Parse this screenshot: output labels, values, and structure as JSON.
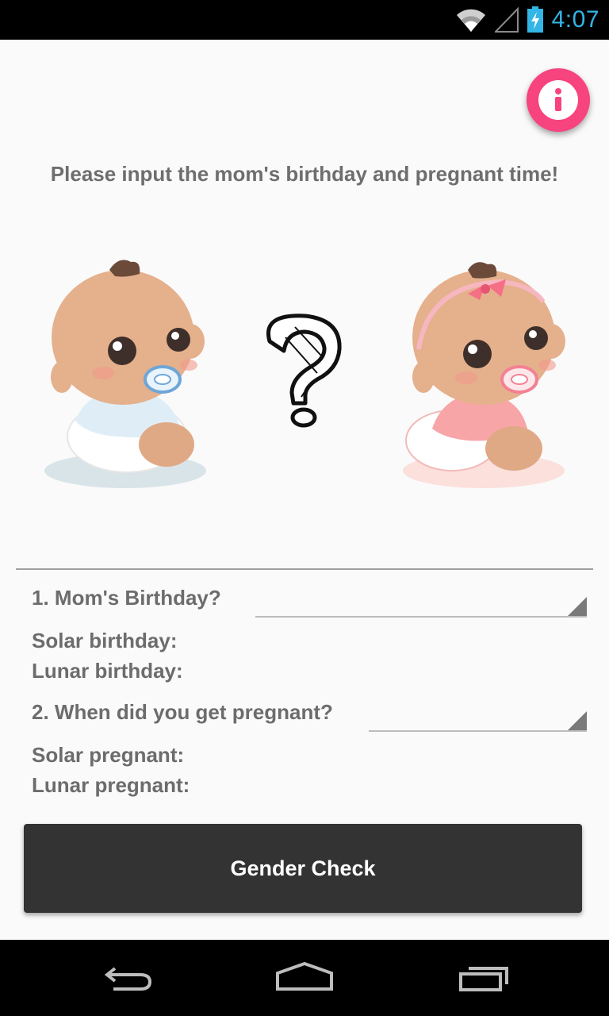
{
  "status_bar": {
    "time": "4:07",
    "icons": [
      "wifi-icon",
      "signal-icon",
      "battery-charging-icon"
    ],
    "accent": "#33b5e5"
  },
  "info_button": {
    "icon": "info-icon",
    "color": "#f7437e"
  },
  "prompt": "Please input the mom's birthday and pregnant time!",
  "illustration": {
    "left": "baby-boy",
    "middle": "question-mark",
    "right": "baby-girl"
  },
  "form": {
    "q1_label": "1. Mom's Birthday?",
    "q1_value": "",
    "solar_birthday_label": "Solar birthday:",
    "lunar_birthday_label": "Lunar birthday:",
    "q2_label": "2. When did you get pregnant?",
    "q2_value": "",
    "solar_pregnant_label": "Solar pregnant:",
    "lunar_pregnant_label": "Lunar pregnant:"
  },
  "gender_check_button": "Gender Check",
  "nav": {
    "back": "back-icon",
    "home": "home-icon",
    "recents": "recents-icon"
  }
}
